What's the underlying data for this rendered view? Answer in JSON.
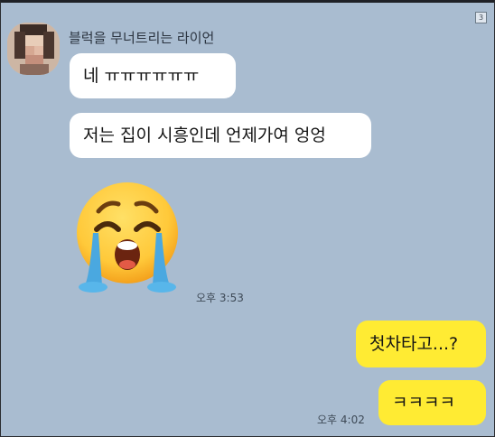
{
  "chat": {
    "badge": "3",
    "sender": "블럭을 무너트리는 라이언",
    "messages": [
      {
        "from": "other",
        "text": "네 ㅠㅠㅠㅠㅠㅠ"
      },
      {
        "from": "other",
        "text": "저는 집이 시흥인데 언제가여 엉엉"
      },
      {
        "from": "other",
        "sticker": "loudly-crying-face-icon",
        "time": "오후 3:53"
      },
      {
        "from": "me",
        "text": "첫차타고...?"
      },
      {
        "from": "me",
        "text": "ㅋㅋㅋㅋ",
        "time": "오후 4:02"
      }
    ]
  },
  "colors": {
    "chat_background": "#a9bcd0",
    "incoming_bubble": "#ffffff",
    "outgoing_bubble": "#ffeb33",
    "emoji_face": "#ffc93a",
    "emoji_tears": "#4aa8e0"
  }
}
